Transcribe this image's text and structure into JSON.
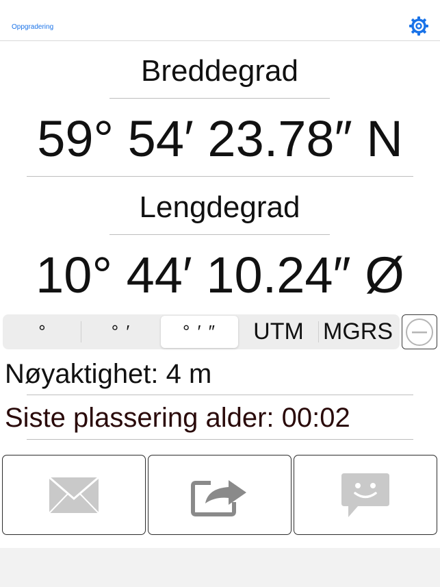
{
  "topbar": {
    "upgrade_label": "Oppgradering",
    "settings_icon": "gear-icon",
    "accent_color": "#1a73e8"
  },
  "latitude": {
    "label": "Breddegrad",
    "value": "59° 54′ 23.78″ N"
  },
  "longitude": {
    "label": "Lengdegrad",
    "value": "10° 44′ 10.24″ Ø"
  },
  "format_selector": {
    "options": [
      {
        "label": "°",
        "selected": false
      },
      {
        "label": "° ′",
        "selected": false
      },
      {
        "label": "° ′ ″",
        "selected": true
      },
      {
        "label": "UTM",
        "selected": false
      },
      {
        "label": "MGRS",
        "selected": false
      }
    ],
    "remove_icon": "minus-circle-icon"
  },
  "info": {
    "accuracy": "Nøyaktighet: 4 m",
    "location_age": "Siste plassering alder: 00:02"
  },
  "actions": {
    "email_icon": "envelope-icon",
    "share_icon": "share-arrow-icon",
    "message_icon": "chat-smiley-icon"
  }
}
